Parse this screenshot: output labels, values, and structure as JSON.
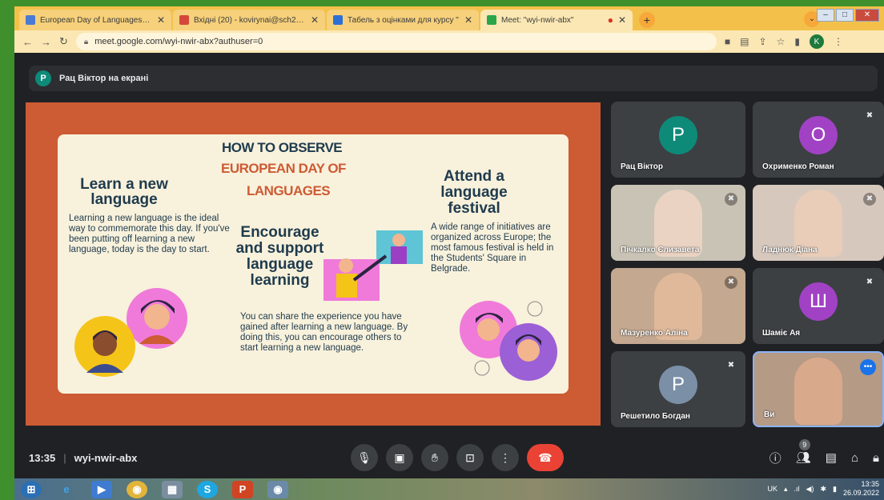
{
  "browser": {
    "tabs": [
      {
        "title": "European Day of Languages » G",
        "fav_color": "#4a7bd4",
        "active": false
      },
      {
        "title": "Вхідні (20) - kovirynai@sch28.ck.",
        "fav_color": "#d4473a",
        "active": false
      },
      {
        "title": "Табель з оцінками для курсу \"",
        "fav_color": "#2d6fd6",
        "active": false
      },
      {
        "title": "Meet: \"wyi-nwir-abx\"",
        "fav_color": "#2aa54a",
        "active": true
      }
    ],
    "new_tab": "+",
    "url": "meet.google.com/wyi-nwir-abx?authuser=0",
    "profile_initial": "K"
  },
  "presenter_banner": {
    "initial": "P",
    "text": "Рац Віктор на екрані"
  },
  "slide": {
    "title_line1": "HOW TO OBSERVE",
    "title_line2": "EUROPEAN DAY OF",
    "title_line3": "LANGUAGES",
    "learn_heading": "Learn a new language",
    "learn_text": "Learning a new language is the ideal way to commemorate this day. If you've been putting off learning a new language, today is the day to start.",
    "encourage_heading": "Encourage and support language learning",
    "encourage_text": "You can share the experience you have gained after learning a new language. By doing this, you can encourage others to start learning a new language.",
    "attend_heading": "Attend a language festival",
    "attend_text": "A wide range of initiatives are organized across Europe; the most famous festival is held in the Students' Square in Belgrade."
  },
  "participants": [
    {
      "name": "Рац Віктор",
      "initial": "P",
      "color": "#0e8a79",
      "video": false,
      "muted": false
    },
    {
      "name": "Охрименко Роман",
      "initial": "O",
      "color": "#a142c4",
      "video": false,
      "muted": true
    },
    {
      "name": "Пічкалко Єлизавета",
      "initial": "",
      "color": "#c9c3b5",
      "video": true,
      "muted": true
    },
    {
      "name": "Ладнюк Діана",
      "initial": "",
      "color": "#d7c8bd",
      "video": true,
      "muted": true
    },
    {
      "name": "Мазуренко Аліна",
      "initial": "",
      "color": "#c4a88f",
      "video": true,
      "muted": true
    },
    {
      "name": "Шаміє Ая",
      "initial": "Ш",
      "color": "#a142c4",
      "video": false,
      "muted": true
    },
    {
      "name": "Решетило Богдан",
      "initial": "P",
      "color": "#7b8fa6",
      "video": false,
      "muted": true
    },
    {
      "name": "Ви",
      "initial": "",
      "color": "#b59a86",
      "video": true,
      "muted": false
    }
  ],
  "meeting": {
    "time": "13:35",
    "code": "wyi-nwir-abx",
    "people_count": "9"
  },
  "taskbar": {
    "lang": "UK",
    "time": "13:35",
    "date": "26.09.2022"
  }
}
